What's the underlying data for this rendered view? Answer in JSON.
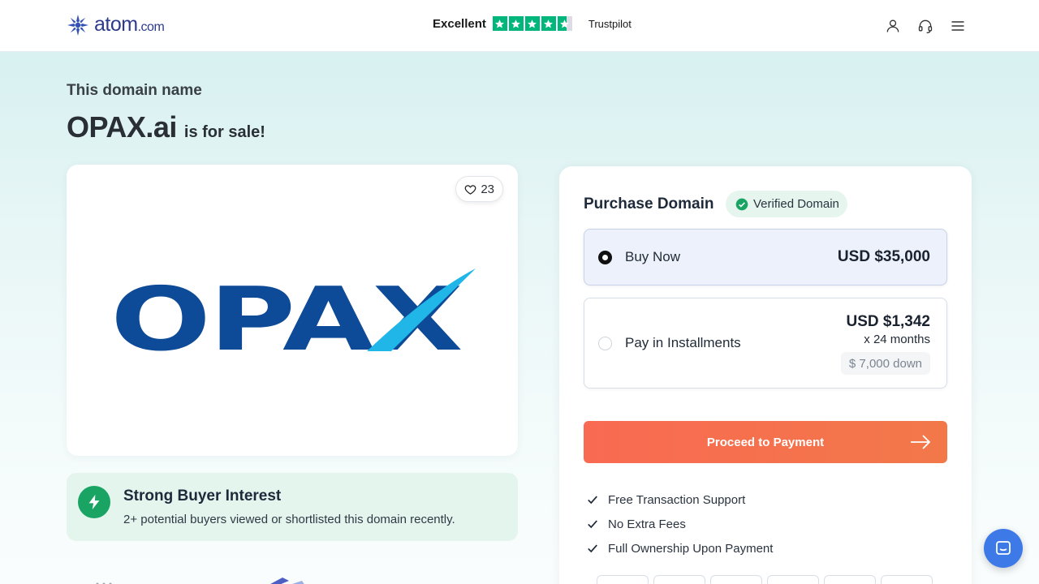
{
  "header": {
    "logo_text": "atom",
    "logo_suffix": ".com",
    "trust_label": "Excellent",
    "trust_brand": "Trustpilot",
    "rating_stars": 4.5,
    "icons": [
      "user-icon",
      "headset-icon",
      "menu-icon"
    ]
  },
  "hero": {
    "subtitle": "This domain name",
    "domain": "OPAX.ai",
    "for_sale": "is for sale!"
  },
  "logo_card": {
    "likes": "23",
    "brand_text": "OPAX"
  },
  "interest": {
    "title": "Strong Buyer Interest",
    "text": "2+ potential buyers viewed or shortlisted this domain recently."
  },
  "purchase": {
    "title": "Purchase Domain",
    "verified": "Verified Domain",
    "options": [
      {
        "label": "Buy Now",
        "price": "USD $35,000",
        "selected": true
      },
      {
        "label": "Pay in Installments",
        "price": "USD $1,342",
        "months": "x 24 months",
        "down": "$ 7,000 down",
        "selected": false
      }
    ],
    "proceed": "Proceed to Payment",
    "benefits": [
      "Free Transaction Support",
      "No Extra Fees",
      "Full Ownership Upon Payment"
    ]
  },
  "colors": {
    "accent_orange": "#f96a52",
    "trust_green": "#00b67a",
    "brand_navy": "#0d4a97",
    "brand_cyan": "#21b6e8",
    "chat_blue": "#3d7ae8"
  }
}
